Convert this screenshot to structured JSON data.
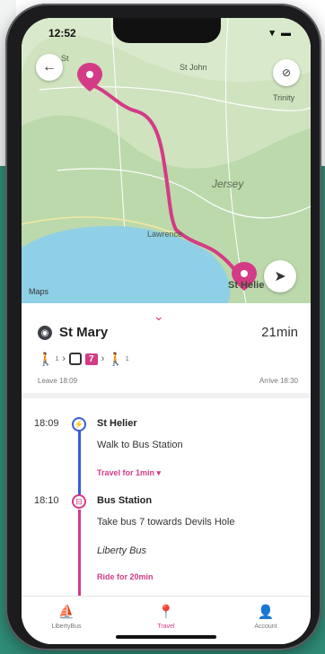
{
  "status_bar": {
    "time": "12:52",
    "icons": "▾ ▬"
  },
  "map": {
    "labels": {
      "st_john": "St John",
      "trinity": "Trinity",
      "jersey": "Jersey",
      "lawrence": "Lawrence",
      "st_helier": "St Helie",
      "st_ouen_bay": "St"
    },
    "attribution": "Maps",
    "route_color": "#d43b86"
  },
  "route": {
    "destination": "St Mary",
    "duration": "21min",
    "leave": "Leave 18:09",
    "arrive": "Arrive 18:30",
    "bus_number": "7",
    "walk_sub1": "1",
    "walk_sub2": "1"
  },
  "steps": [
    {
      "time": "18:09",
      "title": "St Helier",
      "body": "Walk to Bus Station",
      "link": "Travel for 1min ▾"
    },
    {
      "time": "18:10",
      "title": "Bus Station",
      "body": "Take bus 7 towards Devils Hole",
      "operator": "Liberty Bus",
      "link": "Ride for 20min"
    }
  ],
  "tabs": [
    {
      "label": "LibertyBus",
      "icon": "sail-icon"
    },
    {
      "label": "Travel",
      "icon": "map-pin-icon"
    },
    {
      "label": "Account",
      "icon": "person-icon"
    }
  ],
  "colors": {
    "accent": "#d43b86",
    "walk_line": "#3b5bdb",
    "background": "#2f8d77"
  }
}
